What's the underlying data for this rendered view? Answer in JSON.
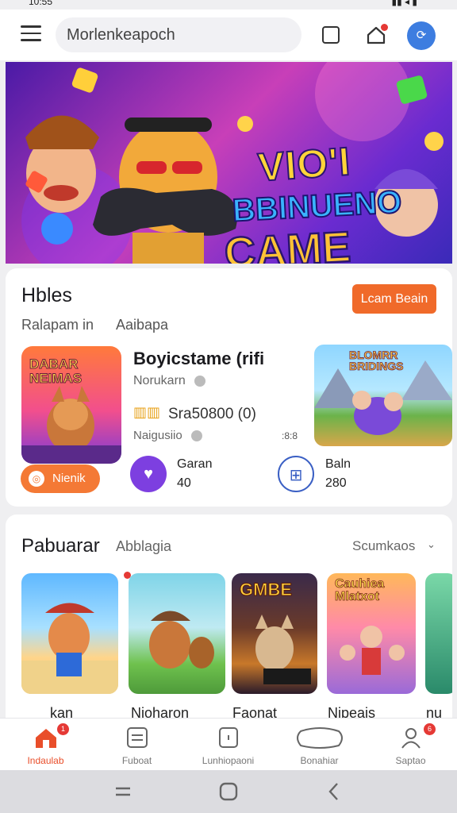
{
  "status": {
    "time": "10:55",
    "icons": "▮▮ ◂ ▮"
  },
  "topbar": {
    "search_text": "Morlenkeapoch",
    "avatar_glyph": "⟳"
  },
  "banner": {
    "line1": "VIO'I",
    "line2": "BBINUENO",
    "line3": "CAME"
  },
  "featured_section": {
    "title": "Hbles",
    "sub_left": "Ralapam in",
    "sub_right": "Aaibapa",
    "action_button": "Lcam Beain",
    "thumb_title": "DABAR NEIMAS",
    "thumb_button": "Nienik",
    "game_title": "Boyicstame (rifi",
    "developer": "Norukarn",
    "stat": "Sra50800 (0)",
    "tag": "Naigusiio",
    "time": ":8:8",
    "mini1_label": "Garan",
    "mini1_value": "40",
    "mini2_label": "Baln",
    "mini2_value": "280",
    "side_thumb_title": "BLOMRR BRIDINGS"
  },
  "popular_section": {
    "title": "Pabuarar",
    "subtitle": "Abblagia",
    "more_label": "Scumkaos",
    "more_chevron": "⌄",
    "games": [
      {
        "label": "kan",
        "title": ""
      },
      {
        "label": "Nioharon",
        "title": ""
      },
      {
        "label": "Faonat",
        "title": "GMBE"
      },
      {
        "label": "Nipeais",
        "title": "Cauhiea Mlatxot"
      },
      {
        "label": "nu",
        "title": ""
      }
    ]
  },
  "bottom_nav": [
    {
      "label": "Indaulab",
      "badge": "1"
    },
    {
      "label": "Fuboat"
    },
    {
      "label": "Lunhiopaoni"
    },
    {
      "label": "Bonahiar"
    },
    {
      "label": "Saptao",
      "badge": "6"
    }
  ],
  "colors": {
    "accent": "#f06a2a",
    "active_nav": "#e94e2a",
    "avatar": "#3d7de0"
  }
}
